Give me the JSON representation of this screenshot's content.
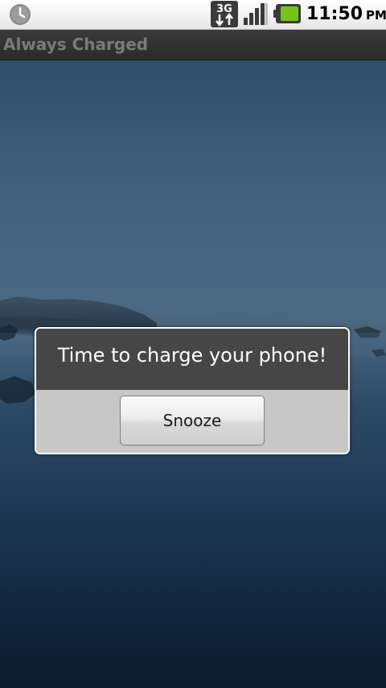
{
  "status_bar": {
    "time": "11:50",
    "ampm": "PM",
    "network_label": "3G",
    "icons": {
      "left": "clock-icon",
      "network": "network-3g-icon",
      "signal": "signal-strength-icon",
      "battery": "battery-icon"
    },
    "battery_level": 0.85,
    "battery_color": "#76c41a"
  },
  "title_bar": {
    "title": "Always Charged"
  },
  "dialog": {
    "message": "Time to charge your phone!",
    "snooze_label": "Snooze"
  },
  "colors": {
    "title_bar_bg": "#2f2f2f",
    "title_text": "#7a7a7a",
    "dialog_message_bg": "#464646",
    "dialog_button_bg": "#c7c7c7"
  }
}
